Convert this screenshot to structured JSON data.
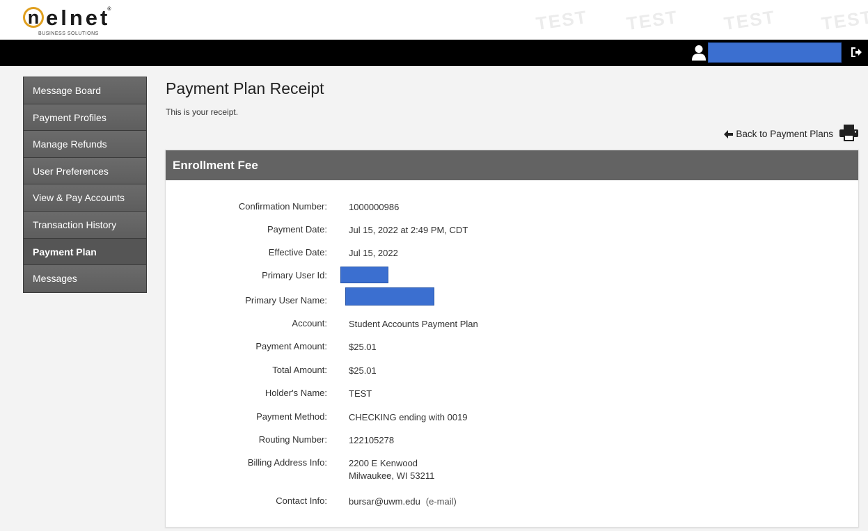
{
  "brand": {
    "name": "nelnet",
    "n_letter": "n",
    "rest_letters": "elnet",
    "registered": "®",
    "tagline": "BUSINESS SOLUTIONS"
  },
  "watermark_text": "TEST",
  "colors": {
    "top_bar": "#000000",
    "sidebar": "#666666",
    "panel_header": "#636363",
    "redaction": "#3b6fd0",
    "logo_ring": "#e0a020"
  },
  "sidebar": {
    "items": [
      {
        "label": "Message Board",
        "active": false
      },
      {
        "label": "Payment Profiles",
        "active": false
      },
      {
        "label": "Manage Refunds",
        "active": false
      },
      {
        "label": "User Preferences",
        "active": false
      },
      {
        "label": "View & Pay Accounts",
        "active": false
      },
      {
        "label": "Transaction History",
        "active": false
      },
      {
        "label": "Payment Plan",
        "active": true
      },
      {
        "label": "Messages",
        "active": false
      }
    ]
  },
  "main": {
    "title": "Payment Plan Receipt",
    "subtitle": "This is your receipt.",
    "back_link": "Back to Payment Plans",
    "panel_title": "Enrollment Fee",
    "fields": {
      "confirmation_number": {
        "label": "Confirmation Number:",
        "value": "1000000986"
      },
      "payment_date": {
        "label": "Payment Date:",
        "value": "Jul 15, 2022 at 2:49 PM, CDT"
      },
      "effective_date": {
        "label": "Effective Date:",
        "value": "Jul 15, 2022"
      },
      "primary_user_id": {
        "label": "Primary User Id:"
      },
      "primary_user_name": {
        "label": "Primary User Name:"
      },
      "account": {
        "label": "Account:",
        "value": "Student Accounts Payment Plan"
      },
      "payment_amount": {
        "label": "Payment Amount:",
        "value": "$25.01"
      },
      "total_amount": {
        "label": "Total Amount:",
        "value": "$25.01"
      },
      "holders_name": {
        "label": "Holder's Name:",
        "value": "TEST"
      },
      "payment_method": {
        "label": "Payment Method:",
        "value": "CHECKING ending with 0019"
      },
      "routing_number": {
        "label": "Routing Number:",
        "value": "122105278"
      },
      "billing_address": {
        "label": "Billing Address Info:",
        "line1": "2200 E Kenwood",
        "line2": "Milwaukee, WI 53211"
      },
      "contact_info": {
        "label": "Contact Info:",
        "value": "bursar@uwm.edu",
        "type": "(e-mail)"
      }
    }
  }
}
